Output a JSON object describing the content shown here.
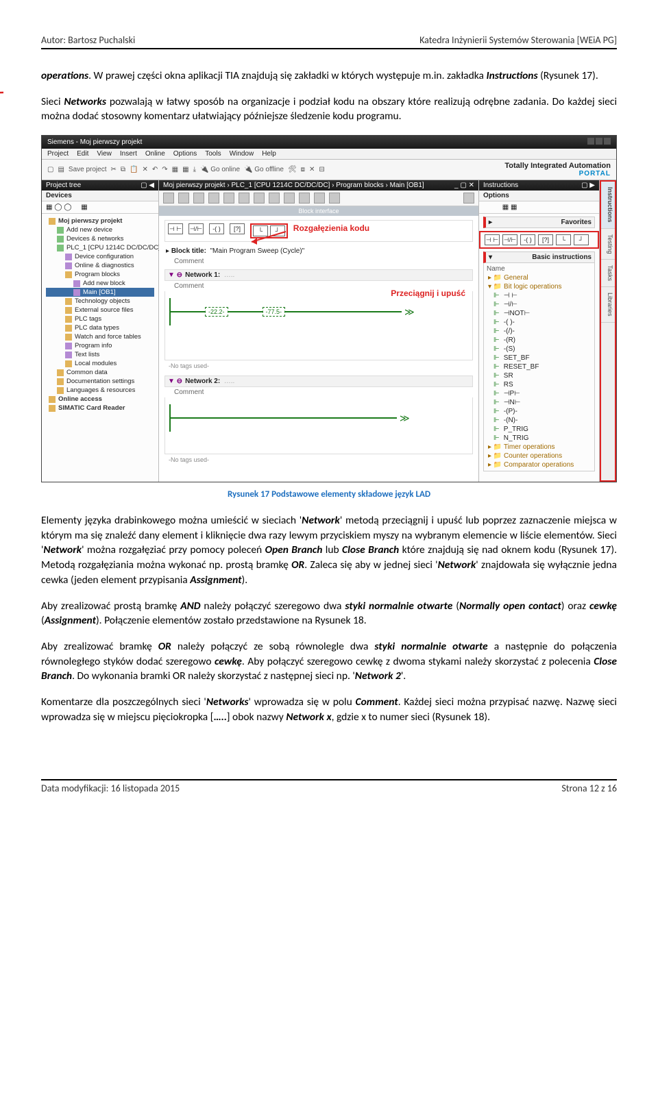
{
  "header": {
    "left": "Autor: Bartosz Puchalski",
    "right": "Katedra Inżynierii Systemów Sterowania [WEiA PG]"
  },
  "p1_a": "operations",
  "p1_b": ". W prawej części okna aplikacji TIA znajdują się zakładki w których występuje m.in. zakładka ",
  "p1_c": "Instructions",
  "p1_d": " (Rysunek 17).",
  "p2_a": "Sieci ",
  "p2_b": "Networks",
  "p2_c": " pozwalają w łatwy sposób na organizacje i podział kodu na obszary które realizują odrębne zadania. Do każdej sieci można dodać stosowny komentarz ułatwiający późniejsze śledzenie kodu programu.",
  "tia": {
    "title": "Siemens  -  Moj pierwszy projekt",
    "menu": [
      "Project",
      "Edit",
      "View",
      "Insert",
      "Online",
      "Options",
      "Tools",
      "Window",
      "Help"
    ],
    "tb_left": [
      "▢",
      "▤",
      "Save project",
      "✂",
      "⧉",
      "📋",
      "✕",
      "↶",
      "↷",
      "▦",
      "▦",
      "⤓",
      "🔌 Go online",
      "🔌 Go offline",
      "🛠",
      "⧈",
      "✕",
      "⊟"
    ],
    "tb_head": "Totally Integrated Automation",
    "tb_sub": "PORTAL",
    "left_panel": "Project tree",
    "left_sub": "Devices",
    "tree": [
      {
        "l": "l1",
        "t": "Moj pierwszy projekt",
        "i": "folder"
      },
      {
        "l": "l2",
        "t": "Add new device",
        "i": "device"
      },
      {
        "l": "l2",
        "t": "Devices & networks",
        "i": "device"
      },
      {
        "l": "l2",
        "t": "PLC_1 [CPU 1214C DC/DC/DC]",
        "i": "device"
      },
      {
        "l": "l3",
        "t": "Device configuration",
        "i": "block"
      },
      {
        "l": "l3",
        "t": "Online & diagnostics",
        "i": "block"
      },
      {
        "l": "l3",
        "t": "Program blocks",
        "i": "folder"
      },
      {
        "l": "l3",
        "t": "Add new block",
        "i": "block",
        "pad": "40px"
      },
      {
        "l": "l3",
        "t": "Main [OB1]",
        "i": "block",
        "sel": true,
        "pad": "40px"
      },
      {
        "l": "l3",
        "t": "Technology objects",
        "i": "folder"
      },
      {
        "l": "l3",
        "t": "External source files",
        "i": "folder"
      },
      {
        "l": "l3",
        "t": "PLC tags",
        "i": "folder"
      },
      {
        "l": "l3",
        "t": "PLC data types",
        "i": "folder"
      },
      {
        "l": "l3",
        "t": "Watch and force tables",
        "i": "folder"
      },
      {
        "l": "l3",
        "t": "Program info",
        "i": "block"
      },
      {
        "l": "l3",
        "t": "Text lists",
        "i": "block"
      },
      {
        "l": "l3",
        "t": "Local modules",
        "i": "folder"
      },
      {
        "l": "l2",
        "t": "Common data",
        "i": "folder"
      },
      {
        "l": "l2",
        "t": "Documentation settings",
        "i": "folder"
      },
      {
        "l": "l2",
        "t": "Languages & resources",
        "i": "folder"
      },
      {
        "l": "l1",
        "t": "Online access",
        "i": "folder"
      },
      {
        "l": "l1",
        "t": "SIMATIC Card Reader",
        "i": "folder"
      }
    ],
    "mid_title": "Moj pierwszy projekt › PLC_1 [CPU 1214C DC/DC/DC] › Program blocks › Main [OB1]",
    "block_iface": "Block interface",
    "annot_branch": "Rozgałęzienia kodu",
    "blk_title_lbl": "Block title:",
    "blk_title_val": "\"Main Program Sweep (Cycle)\"",
    "comment": "Comment",
    "net1": "Network 1:",
    "net2": "Network 2:",
    "drag": "Przeciągnij i upuść",
    "notags": "-No tags used-",
    "ladval1": "-22.2-",
    "ladval2": "-77.5-",
    "right_panel": "Instructions",
    "options": "Options",
    "favorites": "Favorites",
    "basic": "Basic instructions",
    "name": "Name",
    "instr_groups": {
      "general": "General",
      "bitlogic": "Bit logic operations",
      "items": [
        "⊣ ⊢",
        "⊣/⊢",
        "⊣NOT⊢",
        "-( )-",
        "-(/)- ",
        "-(R)",
        "-(S)",
        "SET_BF",
        "RESET_BF",
        "SR",
        "RS",
        "⊣P⊢",
        "⊣N⊢",
        "-(P)-",
        "-(N)-",
        "P_TRIG",
        "N_TRIG"
      ],
      "timer": "Timer operations",
      "counter": "Counter operations",
      "compar": "Comparator operations"
    },
    "sidetabs": [
      "Instructions",
      "Testing",
      "Tasks",
      "Libraries"
    ]
  },
  "caption": "Rysunek 17 Podstawowe elementy składowe język LAD",
  "p3_a": "Elementy języka drabinkowego można umieścić w sieciach '",
  "p3_b": "Network",
  "p3_c": "' metodą przeciągnij i upuść lub poprzez zaznaczenie miejsca w którym ma się znaleźć dany element i kliknięcie dwa razy lewym przyciskiem myszy na wybranym elemencie w liście elementów. Sieci '",
  "p3_d": "Network",
  "p3_e": "' można rozgałęziać przy pomocy poleceń ",
  "p3_f": "Open Branch",
  "p3_g": " lub ",
  "p3_h": "Close Branch",
  "p3_i": " które znajdują się nad oknem kodu (Rysunek 17). Metodą rozgałęziania można wykonać np. prostą bramkę ",
  "p3_j": "OR",
  "p3_k": ". Zaleca się aby w jednej sieci '",
  "p3_l": "Network",
  "p3_m": "' znajdowała się wyłącznie jedna cewka (jeden element przypisania ",
  "p3_n": "Assignment",
  "p3_o": ").",
  "p4_a": "Aby zrealizować prostą bramkę ",
  "p4_b": "AND",
  "p4_c": " należy połączyć szeregowo dwa ",
  "p4_d": "styki normalnie otwarte",
  "p4_e": " (",
  "p4_f": "Normally open contact",
  "p4_g": ") oraz ",
  "p4_h": "cewkę",
  "p4_i": " (",
  "p4_j": "Assignment",
  "p4_k": "). Połączenie elementów zostało przedstawione na Rysunek 18.",
  "p5_a": "Aby zrealizować bramkę ",
  "p5_b": "OR",
  "p5_c": " należy połączyć ze sobą równolegle dwa ",
  "p5_d": "styki normalnie otwarte",
  "p5_e": " a następnie do połączenia równoległego styków dodać szeregowo ",
  "p5_f": "cewkę",
  "p5_g": ". Aby połączyć szeregowo cewkę z dwoma stykami należy skorzystać z polecenia ",
  "p5_h": "Close Branch",
  "p5_i": ". Do wykonania bramki OR należy skorzystać z następnej sieci np. '",
  "p5_j": "Network 2",
  "p5_k": "'.",
  "p6_a": "Komentarze dla poszczególnych sieci '",
  "p6_b": "Networks",
  "p6_c": "' wprowadza się w polu ",
  "p6_d": "Comment",
  "p6_e": ". Każdej sieci można przypisać nazwę. Nazwę sieci wprowadza się w miejscu pięciokropka [",
  "p6_f": "…..",
  "p6_g": "] obok nazwy ",
  "p6_h": "Network x",
  "p6_i": ", gdzie x to numer sieci (Rysunek 18).",
  "footer": {
    "left": "Data modyfikacji: 16 listopada 2015",
    "right": "Strona 12 z 16"
  }
}
